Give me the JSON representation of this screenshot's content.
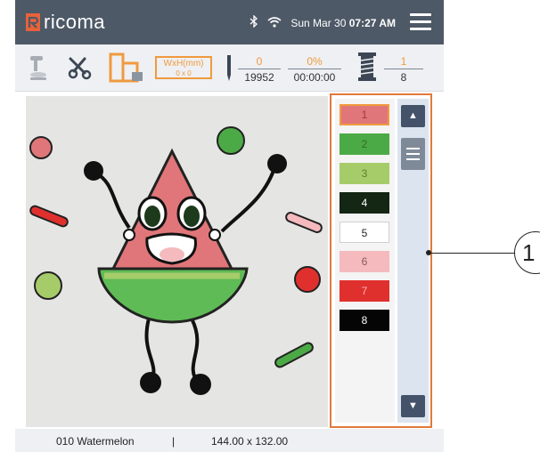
{
  "app": {
    "logo_text": "ricoma",
    "brand_color": "#e8623a"
  },
  "status_bar": {
    "bluetooth_icon": "bluetooth-icon",
    "wifi_icon": "wifi-icon",
    "date": "Sun Mar 30",
    "time": "07:27 AM"
  },
  "toolbar": {
    "size_label": "WxH(mm)",
    "size_value": "0 x 0",
    "stitch_current": "0",
    "stitch_total": "19952",
    "progress_percent": "0%",
    "elapsed_time": "00:00:00",
    "color_current": "1",
    "color_total": "8"
  },
  "color_list": [
    {
      "label": "1",
      "color": "#e07679",
      "text_color": "#9c3a3d",
      "selected": true
    },
    {
      "label": "2",
      "color": "#4caa46",
      "text_color": "#2d6e29",
      "selected": false
    },
    {
      "label": "3",
      "color": "#a6cc6a",
      "text_color": "#5d7d30",
      "selected": false
    },
    {
      "label": "4",
      "color": "#142614",
      "text_color": "#ffffff",
      "selected": false
    },
    {
      "label": "5",
      "color": "#ffffff",
      "text_color": "#222222",
      "selected": false
    },
    {
      "label": "6",
      "color": "#f4babd",
      "text_color": "#8a5a5c",
      "selected": false
    },
    {
      "label": "7",
      "color": "#e0302e",
      "text_color": "#f6b3b2",
      "selected": false
    },
    {
      "label": "8",
      "color": "#050505",
      "text_color": "#ffffff",
      "selected": false
    }
  ],
  "footer": {
    "design_name": "010 Watermelon",
    "separator": "|",
    "dimensions": "144.00 x 132.00"
  },
  "callout": {
    "label": "1"
  }
}
